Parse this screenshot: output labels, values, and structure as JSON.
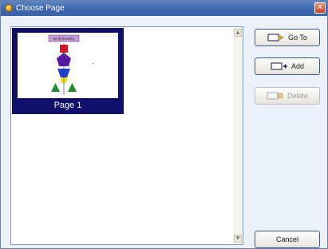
{
  "window": {
    "title": "Choose Page",
    "close_glyph": "✕"
  },
  "pages": [
    {
      "label": "Page 1",
      "thumb_text": "ex Symmetry"
    }
  ],
  "buttons": {
    "goto_label": "Go To",
    "add_label": "Add",
    "delete_label": "Delete",
    "cancel_label": "Cancel"
  },
  "icons": {
    "goto": "go-to-page-icon",
    "add": "add-page-icon",
    "delete": "delete-page-icon"
  },
  "colors": {
    "title_bar": "#3f67ad",
    "thumb_frame": "#10106a",
    "button_border": "#3c5a94"
  }
}
